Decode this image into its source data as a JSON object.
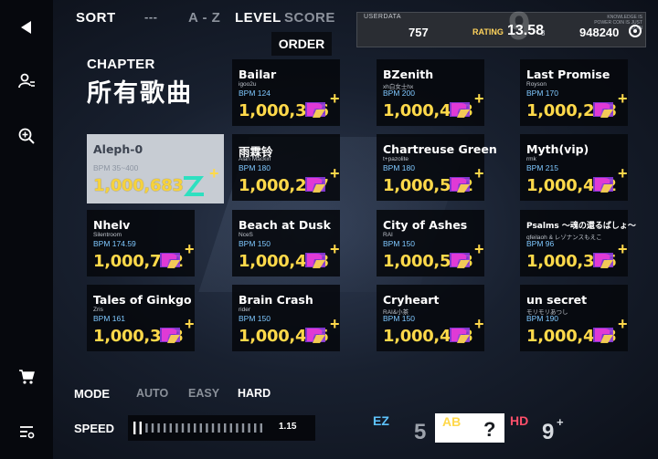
{
  "sidebar": {
    "back_icon": "triangle-left-icon",
    "profile_icon": "user-list-icon",
    "search_icon": "zoom-in-icon",
    "store_icon": "cart-icon",
    "settings_icon": "list-settings-icon"
  },
  "toolbar": {
    "sort_label": "SORT",
    "dash_label": "---",
    "az_label": "A - Z",
    "level_label": "LEVEL",
    "score_label": "SCORE",
    "order_label": "ORDER"
  },
  "userdata": {
    "title": "USERDATA",
    "level": "9",
    "count": "757",
    "rating_label": "RATING",
    "rating": "13.58",
    "rating_sub": "3",
    "note": "KNOWLEDGE IS POWER COIN IS JUST COIN",
    "score": "948240"
  },
  "chapter": {
    "label": "CHAPTER",
    "name": "所有歌曲"
  },
  "songs": [
    {
      "title": "Aleph-0",
      "artist": "",
      "bpm": "BPM 35~400",
      "score": "1,000,683",
      "selected": true
    },
    {
      "title": "Bailar",
      "artist": "igoo2u",
      "bpm": "BPM 124",
      "score": "1,000,326"
    },
    {
      "title": "BZenith",
      "artist": "xh白女士hx",
      "bpm": "BPM 200",
      "score": "1,000,423"
    },
    {
      "title": "Last Promise",
      "artist": "Royson",
      "bpm": "BPM 170",
      "score": "1,000,238"
    },
    {
      "title": "雨霖铃",
      "artist": "Alan Mackin",
      "bpm": "BPM 180",
      "score": "1,000,277"
    },
    {
      "title": "Chartreuse Green",
      "artist": "t+pazolite",
      "bpm": "BPM 180",
      "score": "1,000,512"
    },
    {
      "title": "Myth(vip)",
      "artist": "rmk",
      "bpm": "BPM 215",
      "score": "1,000,462"
    },
    {
      "title": "Nhelv",
      "artist": "Silentroom",
      "bpm": "BPM 174.59",
      "score": "1,000,742"
    },
    {
      "title": "Beach at Dusk",
      "artist": "NceS",
      "bpm": "BPM 150",
      "score": "1,000,418"
    },
    {
      "title": "City of Ashes",
      "artist": "RAI",
      "bpm": "BPM 150",
      "score": "1,000,523"
    },
    {
      "title": "Psalms ～魂の還るばしょ～",
      "artist": "qfeilaoh & レゾナンスもえこ",
      "bpm": "BPM 96",
      "score": "1,000,375",
      "small": true
    },
    {
      "title": "Tales of Ginkgo",
      "artist": "Zris",
      "bpm": "BPM 161",
      "score": "1,000,363"
    },
    {
      "title": "Brain Crash",
      "artist": "rider",
      "bpm": "BPM 150",
      "score": "1,000,425"
    },
    {
      "title": "Cryheart",
      "artist": "RAI&小茶",
      "bpm": "BPM 150",
      "score": "1,000,403"
    },
    {
      "title": "un secret",
      "artist": "モリモリあつし",
      "bpm": "BPM 190",
      "score": "1,000,413"
    }
  ],
  "card_badge": {
    "plus": "+",
    "icon": "rank-badge-icon",
    "colors": {
      "pink": "#e03ad6",
      "purple": "#8b3ae0",
      "yellow": "#ffd94a",
      "teal": "#2ee0c0"
    }
  },
  "mode": {
    "label": "MODE",
    "options": [
      "AUTO",
      "EASY",
      "HARD"
    ],
    "active": "HARD"
  },
  "speed": {
    "label": "SPEED",
    "value": "1.15",
    "level": 0.1
  },
  "difficulty": {
    "ez_label": "EZ",
    "ez_level": "5",
    "ab_label": "AB",
    "ab_level": "?",
    "hd_label": "HD",
    "hd_level": "9",
    "hd_plus": "+"
  }
}
